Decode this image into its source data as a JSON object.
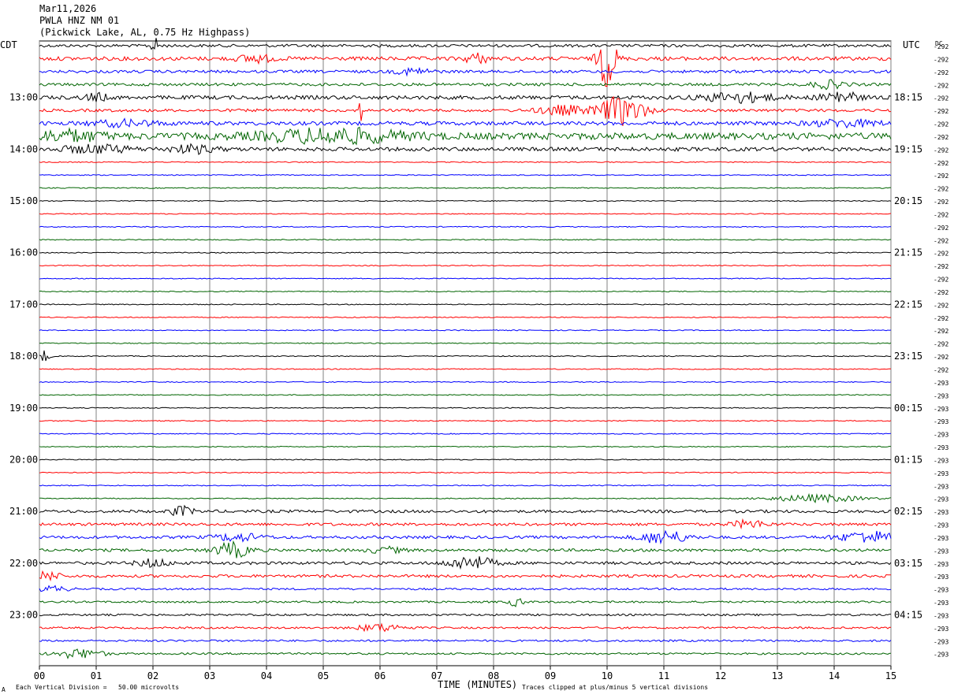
{
  "header": {
    "date": "Mar11,2026",
    "station": "PWLA HNZ NM 01",
    "location": "(Pickwick Lake, AL, 0.75 Hz Highpass)"
  },
  "axes": {
    "left_tz": "CDT",
    "right_tz": "UTC",
    "dc_label": "DC",
    "xlabel": "TIME (MINUTES)"
  },
  "footer": {
    "division_note": "Each Vertical Division =   50.00 microvolts",
    "clip_note": "Traces clipped at plus/minus 5 vertical divisions",
    "corner_mark": "A"
  },
  "colors": {
    "cycle": [
      "#000000",
      "#ff0000",
      "#0000ff",
      "#006400"
    ],
    "grid": "#808080"
  },
  "chart_data": {
    "type": "line",
    "xlim": [
      0,
      15
    ],
    "x_ticks": [
      "00",
      "01",
      "02",
      "03",
      "04",
      "05",
      "06",
      "07",
      "08",
      "09",
      "10",
      "11",
      "12",
      "13",
      "14",
      "15"
    ],
    "trace_minutes": 15,
    "traces_per_hour": 4,
    "left_hour_labels": [
      "13:00",
      "14:00",
      "15:00",
      "16:00",
      "17:00",
      "18:00",
      "19:00",
      "20:00",
      "21:00",
      "22:00",
      "23:00"
    ],
    "left_label_trace_index": [
      4,
      8,
      12,
      16,
      20,
      24,
      28,
      32,
      36,
      40,
      44
    ],
    "right_hour_labels": [
      "18:15",
      "19:15",
      "20:15",
      "21:15",
      "22:15",
      "23:15",
      "00:15",
      "01:15",
      "02:15",
      "03:15",
      "04:15"
    ],
    "dc_offsets": [
      "-292",
      "-292",
      "-292",
      "-292",
      "-292",
      "-292",
      "-292",
      "-292",
      "-292",
      "-292",
      "-292",
      "-292",
      "-292",
      "-292",
      "-292",
      "-292",
      "-292",
      "-292",
      "-292",
      "-292",
      "-292",
      "-292",
      "-292",
      "-292",
      "-292",
      "-292",
      "-293",
      "-293",
      "-293",
      "-293",
      "-293",
      "-293",
      "-293",
      "-293",
      "-293",
      "-293",
      "-293",
      "-293",
      "-293",
      "-293",
      "-293",
      "-293",
      "-293",
      "-293",
      "-293",
      "-293",
      "-293",
      "-293"
    ],
    "noise_level": [
      3,
      4,
      3,
      3,
      4,
      3,
      4,
      7,
      4,
      1,
      1,
      1,
      1,
      1,
      1,
      1,
      1,
      1,
      1,
      1,
      1,
      1,
      1,
      1,
      1,
      1,
      1,
      1,
      1,
      1,
      1,
      1,
      1,
      1,
      1,
      1,
      3,
      3,
      3,
      3,
      3,
      3,
      2,
      2,
      2,
      2,
      2,
      2
    ],
    "events": [
      {
        "trace": 0,
        "minute": 2.05,
        "amp": 14,
        "dur": 0.1
      },
      {
        "trace": 1,
        "minute": 10.0,
        "amp": 60,
        "dur": 0.15
      },
      {
        "trace": 1,
        "minute": 7.7,
        "amp": 10,
        "dur": 0.2
      },
      {
        "trace": 1,
        "minute": 3.8,
        "amp": 8,
        "dur": 0.3
      },
      {
        "trace": 2,
        "minute": 6.6,
        "amp": 7,
        "dur": 0.3
      },
      {
        "trace": 3,
        "minute": 13.9,
        "amp": 8,
        "dur": 0.3
      },
      {
        "trace": 4,
        "minute": 12.3,
        "amp": 10,
        "dur": 0.6
      },
      {
        "trace": 4,
        "minute": 14.1,
        "amp": 14,
        "dur": 0.3
      },
      {
        "trace": 4,
        "minute": 1.0,
        "amp": 8,
        "dur": 0.2
      },
      {
        "trace": 5,
        "minute": 10.25,
        "amp": 30,
        "dur": 0.4
      },
      {
        "trace": 5,
        "minute": 9.2,
        "amp": 10,
        "dur": 0.4
      },
      {
        "trace": 5,
        "minute": 5.65,
        "amp": 22,
        "dur": 0.05
      },
      {
        "trace": 6,
        "minute": 1.5,
        "amp": 6,
        "dur": 0.6
      },
      {
        "trace": 6,
        "minute": 14.2,
        "amp": 7,
        "dur": 0.6
      },
      {
        "trace": 7,
        "minute": 5.2,
        "amp": 14,
        "dur": 1.2
      },
      {
        "trace": 7,
        "minute": 0.5,
        "amp": 10,
        "dur": 0.6
      },
      {
        "trace": 8,
        "minute": 1.0,
        "amp": 8,
        "dur": 0.6
      },
      {
        "trace": 8,
        "minute": 2.7,
        "amp": 8,
        "dur": 0.4
      },
      {
        "trace": 24,
        "minute": 0.1,
        "amp": 14,
        "dur": 0.08
      },
      {
        "trace": 35,
        "minute": 13.7,
        "amp": 8,
        "dur": 0.8
      },
      {
        "trace": 36,
        "minute": 2.5,
        "amp": 10,
        "dur": 0.2
      },
      {
        "trace": 37,
        "minute": 12.5,
        "amp": 8,
        "dur": 0.3
      },
      {
        "trace": 38,
        "minute": 11.0,
        "amp": 14,
        "dur": 0.4
      },
      {
        "trace": 38,
        "minute": 14.6,
        "amp": 12,
        "dur": 0.5
      },
      {
        "trace": 38,
        "minute": 3.5,
        "amp": 8,
        "dur": 0.4
      },
      {
        "trace": 39,
        "minute": 3.4,
        "amp": 16,
        "dur": 0.3
      },
      {
        "trace": 39,
        "minute": 6.1,
        "amp": 6,
        "dur": 0.3
      },
      {
        "trace": 40,
        "minute": 7.6,
        "amp": 14,
        "dur": 0.4
      },
      {
        "trace": 40,
        "minute": 2.0,
        "amp": 8,
        "dur": 0.3
      },
      {
        "trace": 41,
        "minute": 0.15,
        "amp": 10,
        "dur": 0.2
      },
      {
        "trace": 42,
        "minute": 0.2,
        "amp": 6,
        "dur": 0.3
      },
      {
        "trace": 43,
        "minute": 8.4,
        "amp": 8,
        "dur": 0.15
      },
      {
        "trace": 45,
        "minute": 6.0,
        "amp": 8,
        "dur": 0.4
      },
      {
        "trace": 47,
        "minute": 0.7,
        "amp": 10,
        "dur": 0.4
      }
    ]
  }
}
